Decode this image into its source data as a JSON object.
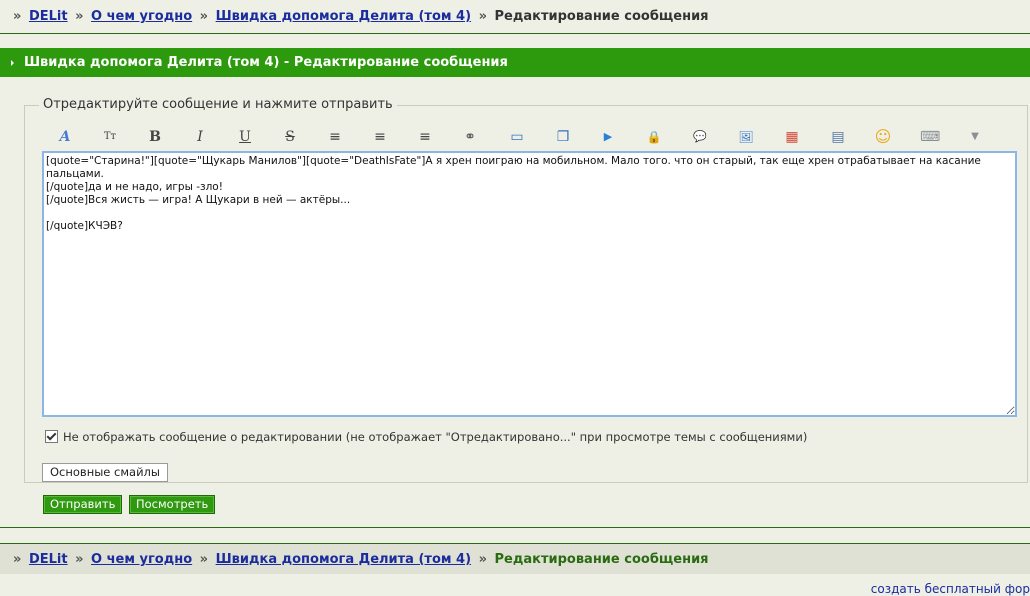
{
  "breadcrumb": {
    "prefix": "»",
    "items": [
      "DELit",
      "О чем угодно",
      "Швидка допомога Делита (том 4)"
    ],
    "current": "Редактирование сообщения"
  },
  "title_bar": {
    "text": "Швидка допомога Делита (том 4) - Редактирование сообщения"
  },
  "form": {
    "legend": "Отредактируйте сообщение и нажмите отправить",
    "toolbar": [
      {
        "name": "font-face-icon",
        "glyph": "A",
        "title": "Шрифт"
      },
      {
        "name": "font-size-icon",
        "glyph": "Tт",
        "title": "Размер"
      },
      {
        "name": "bold-icon",
        "glyph": "B",
        "title": "Жирный"
      },
      {
        "name": "italic-icon",
        "glyph": "I",
        "title": "Курсив"
      },
      {
        "name": "underline-icon",
        "glyph": "U",
        "title": "Подчеркнутый"
      },
      {
        "name": "strike-icon",
        "glyph": "S",
        "title": "Зачеркнутый"
      },
      {
        "name": "align-left-icon",
        "glyph": "≡",
        "title": "По левому краю"
      },
      {
        "name": "align-center-icon",
        "glyph": "≡",
        "title": "По центру"
      },
      {
        "name": "align-right-icon",
        "glyph": "≡",
        "title": "По правому краю"
      },
      {
        "name": "link-icon",
        "glyph": "⚭",
        "title": "Ссылка"
      },
      {
        "name": "book-icon",
        "glyph": "▭",
        "title": "Цитата"
      },
      {
        "name": "copy-icon",
        "glyph": "❐",
        "title": "Код"
      },
      {
        "name": "media-icon",
        "glyph": "▶",
        "title": "Видео"
      },
      {
        "name": "lock-icon",
        "glyph": "🔒",
        "title": "Скрытый текст"
      },
      {
        "name": "speech-icon",
        "glyph": "💬",
        "title": "Спойлер"
      },
      {
        "name": "image-icon",
        "glyph": "🖼",
        "title": "Изображение"
      },
      {
        "name": "color-icon",
        "glyph": "▦",
        "title": "Цвет"
      },
      {
        "name": "table-icon",
        "glyph": "▤",
        "title": "Таблица"
      },
      {
        "name": "smile-icon",
        "glyph": "☺",
        "title": "Смайлы"
      },
      {
        "name": "keyboard-icon",
        "glyph": "⌨",
        "title": "Раскладка"
      },
      {
        "name": "more-icon",
        "glyph": "▼",
        "title": "Ещё"
      }
    ],
    "message": "[quote=\"Старина!\"][quote=\"Щукарь Манилов\"][quote=\"DeathIsFate\"]А я хрен поиграю на мобильном. Мало того. что он старый, так еще хрен отрабатывает на касание пальцами.\n[/quote]да и не надо, игры -зло!\n[/quote]Вся жисть — игра! А Щукари в ней — актёры...\n\n[/quote]КЧЭВ?",
    "checkbox_label": "Не отображать сообщение о редактировании (не отображает \"Отредактировано...\" при просмотре темы с сообщениями)",
    "checkbox_checked": true,
    "smiles_button": "Основные смайлы",
    "submit_button": "Отправить",
    "preview_button": "Посмотреть"
  },
  "footer": {
    "link": "создать бесплатный фор"
  },
  "colors": {
    "accent": "#2d990c",
    "link": "#1a2c9e",
    "background": "#eef0e6"
  }
}
